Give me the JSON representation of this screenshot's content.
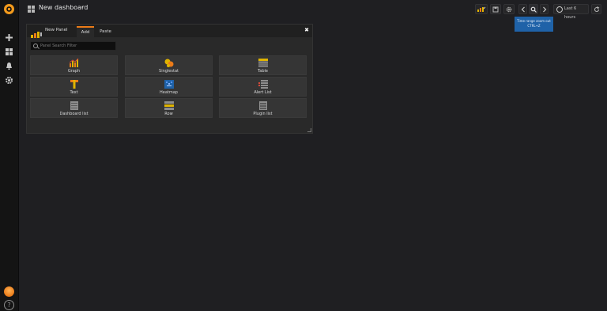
{
  "topbar": {
    "dashboard_title": "New dashboard",
    "caret": "▾",
    "time_range_label": "Last 6 hours",
    "tooltip_line1": "Time range zoom out",
    "tooltip_line2": "CTRL+Z"
  },
  "panel": {
    "title": "New Panel",
    "tabs": [
      "Add",
      "Paste"
    ],
    "active_tab": "Add",
    "close_label": "✖",
    "search_placeholder": "Panel Search Filter",
    "search_value": "",
    "cards": [
      "Graph",
      "Singlestat",
      "Table",
      "Text",
      "Heatmap",
      "Alert List",
      "Dashboard list",
      "Row",
      "Plugin list"
    ]
  },
  "sidebar": {
    "items": [
      "plus-icon",
      "dashboards-icon",
      "bell-icon",
      "gear-icon"
    ],
    "help_label": "?"
  },
  "colors": {
    "brand": "#eb7b18",
    "tooltip": "#1f62a8",
    "background": "#1f1f22"
  }
}
